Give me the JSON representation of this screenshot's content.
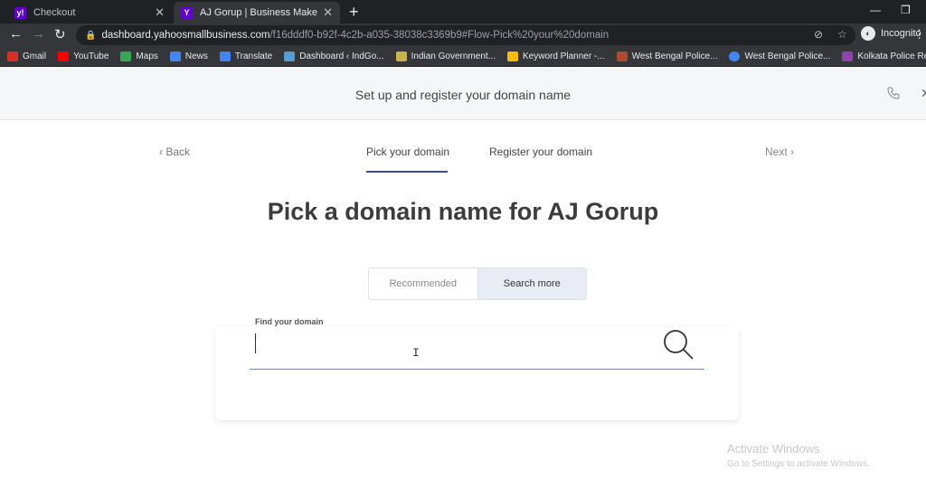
{
  "browser": {
    "tabs": [
      {
        "title": "Checkout",
        "favicon": "y!"
      },
      {
        "title": "AJ Gorup | Business Maker Dashb",
        "favicon": "Y"
      }
    ],
    "url_host": "dashboard.yahoosmallbusiness.com",
    "url_path": "/f16dddf0-b92f-4c2b-a035-38038c3369b9#Flow-Pick%20your%20domain",
    "incognito_label": "Incognito",
    "bookmarks": [
      {
        "label": "Gmail",
        "color": "#d93025"
      },
      {
        "label": "YouTube",
        "color": "#ff0000"
      },
      {
        "label": "Maps",
        "color": "#34a853"
      },
      {
        "label": "News",
        "color": "#4285f4"
      },
      {
        "label": "Translate",
        "color": "#4285f4"
      },
      {
        "label": "Dashboard ‹ IndGo...",
        "color": "#5b9bd5"
      },
      {
        "label": "Indian Government...",
        "color": "#c9b44a"
      },
      {
        "label": "Keyword Planner -...",
        "color": "#fbbc04"
      },
      {
        "label": "West Bengal Police...",
        "color": "#b04a2f"
      },
      {
        "label": "West Bengal Police...",
        "color": "#4285f4"
      },
      {
        "label": "Kolkata Police Recr...",
        "color": "#8e44ad"
      }
    ]
  },
  "header": {
    "title": "Set up and register your domain name"
  },
  "nav": {
    "back": "Back",
    "next": "Next",
    "steps": [
      "Pick your domain",
      "Register your domain"
    ]
  },
  "main": {
    "title": "Pick a domain name for AJ Gorup"
  },
  "toggle": {
    "options": [
      "Recommended",
      "Search more"
    ],
    "selected": "Search more"
  },
  "search": {
    "label": "Find your domain",
    "value": ""
  },
  "watermark": {
    "line1": "Activate Windows",
    "line2": "Go to Settings to activate Windows."
  },
  "colors": {
    "accent": "#3a4aa8",
    "yahoo_purple": "#6001d2"
  }
}
